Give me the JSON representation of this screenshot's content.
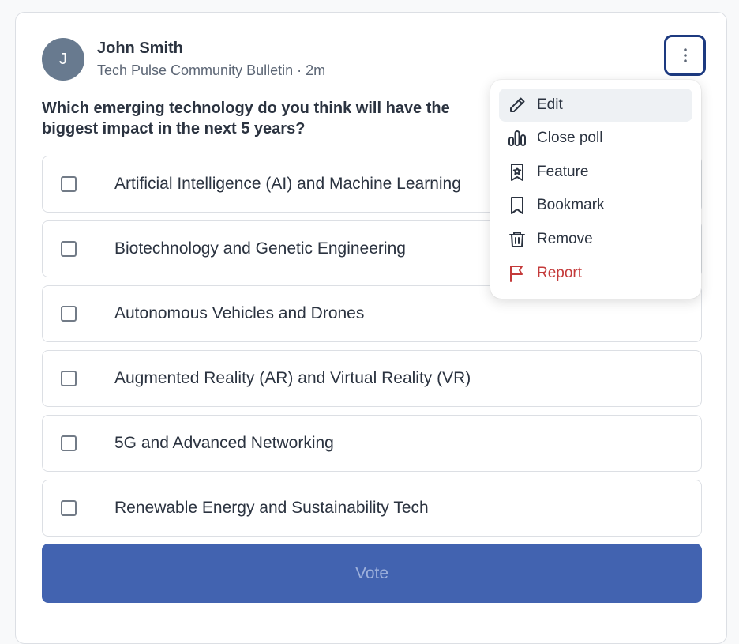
{
  "post": {
    "avatar_initial": "J",
    "author": "John Smith",
    "meta": "Tech Pulse Community Bulletin · 2m",
    "question": "Which emerging technology do you think will have the biggest impact in the next 5 years?"
  },
  "options": [
    {
      "label": "Artificial Intelligence (AI) and Machine Learning",
      "checked": false
    },
    {
      "label": "Biotechnology and Genetic Engineering",
      "checked": false
    },
    {
      "label": "Autonomous Vehicles and Drones",
      "checked": false
    },
    {
      "label": "Augmented Reality (AR) and Virtual Reality (VR)",
      "checked": false
    },
    {
      "label": "5G and Advanced Networking",
      "checked": false
    },
    {
      "label": "Renewable Energy and Sustainability Tech",
      "checked": false
    }
  ],
  "vote_button": {
    "label": "Vote"
  },
  "menu": {
    "items": [
      {
        "label": "Edit",
        "icon": "pencil-icon"
      },
      {
        "label": "Close poll",
        "icon": "bar-chart-icon"
      },
      {
        "label": "Feature",
        "icon": "star-badge-icon"
      },
      {
        "label": "Bookmark",
        "icon": "bookmark-icon"
      },
      {
        "label": "Remove",
        "icon": "trash-icon"
      },
      {
        "label": "Report",
        "icon": "flag-icon"
      }
    ]
  },
  "colors": {
    "accent": "#4263b0",
    "focus_ring": "#1d3a80",
    "danger": "#c43a3a",
    "avatar_bg": "#687a8f"
  }
}
